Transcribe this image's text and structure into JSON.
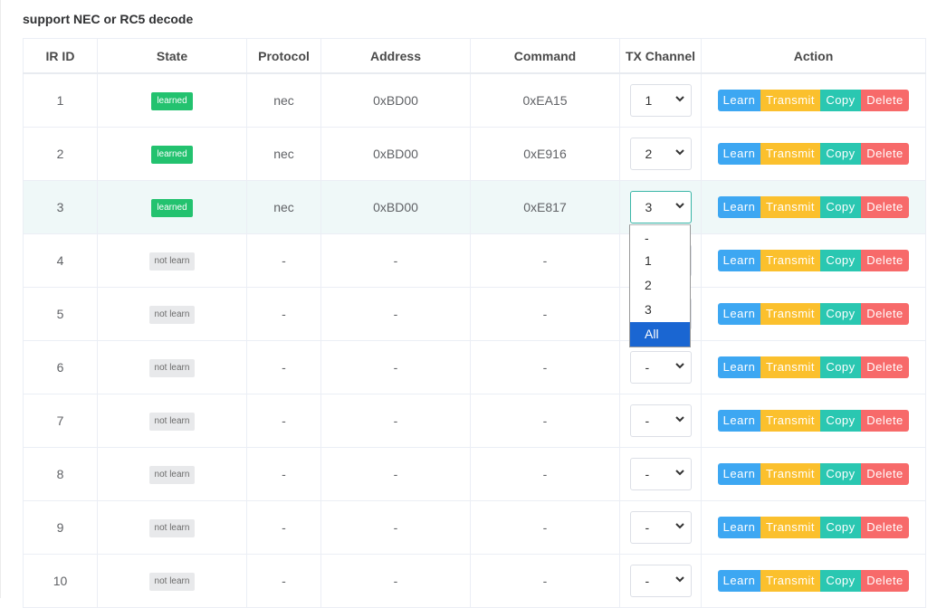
{
  "page": {
    "title": "support NEC or RC5 decode"
  },
  "table": {
    "headers": [
      "IR ID",
      "State",
      "Protocol",
      "Address",
      "Command",
      "TX Channel",
      "Action"
    ],
    "rows": [
      {
        "id": "1",
        "state": "learned",
        "protocol": "nec",
        "address": "0xBD00",
        "command": "0xEA15",
        "channel": "1"
      },
      {
        "id": "2",
        "state": "learned",
        "protocol": "nec",
        "address": "0xBD00",
        "command": "0xE916",
        "channel": "2"
      },
      {
        "id": "3",
        "state": "learned",
        "protocol": "nec",
        "address": "0xBD00",
        "command": "0xE817",
        "channel": "3"
      },
      {
        "id": "4",
        "state": "not learn",
        "protocol": "-",
        "address": "-",
        "command": "-",
        "channel": "-"
      },
      {
        "id": "5",
        "state": "not learn",
        "protocol": "-",
        "address": "-",
        "command": "-",
        "channel": "-"
      },
      {
        "id": "6",
        "state": "not learn",
        "protocol": "-",
        "address": "-",
        "command": "-",
        "channel": "-"
      },
      {
        "id": "7",
        "state": "not learn",
        "protocol": "-",
        "address": "-",
        "command": "-",
        "channel": "-"
      },
      {
        "id": "8",
        "state": "not learn",
        "protocol": "-",
        "address": "-",
        "command": "-",
        "channel": "-"
      },
      {
        "id": "9",
        "state": "not learn",
        "protocol": "-",
        "address": "-",
        "command": "-",
        "channel": "-"
      },
      {
        "id": "10",
        "state": "not learn",
        "protocol": "-",
        "address": "-",
        "command": "-",
        "channel": "-"
      }
    ],
    "actions": {
      "learn": "Learn",
      "transmit": "Transmit",
      "copy": "Copy",
      "delete": "Delete"
    }
  },
  "channel_dropdown": {
    "open_on_row": "3",
    "options": [
      "-",
      "1",
      "2",
      "3",
      "All"
    ],
    "highlighted": "All"
  },
  "colors": {
    "learned_badge": "#23c26f",
    "not_learn_badge": "#e8e9eb",
    "learn_button": "#3da7f2",
    "transmit_button": "#fbc02d",
    "copy_button": "#2ac7b1",
    "delete_button": "#f76a6a",
    "selected_row": "#eff8f8",
    "dropdown_highlight": "#1a66d2"
  }
}
